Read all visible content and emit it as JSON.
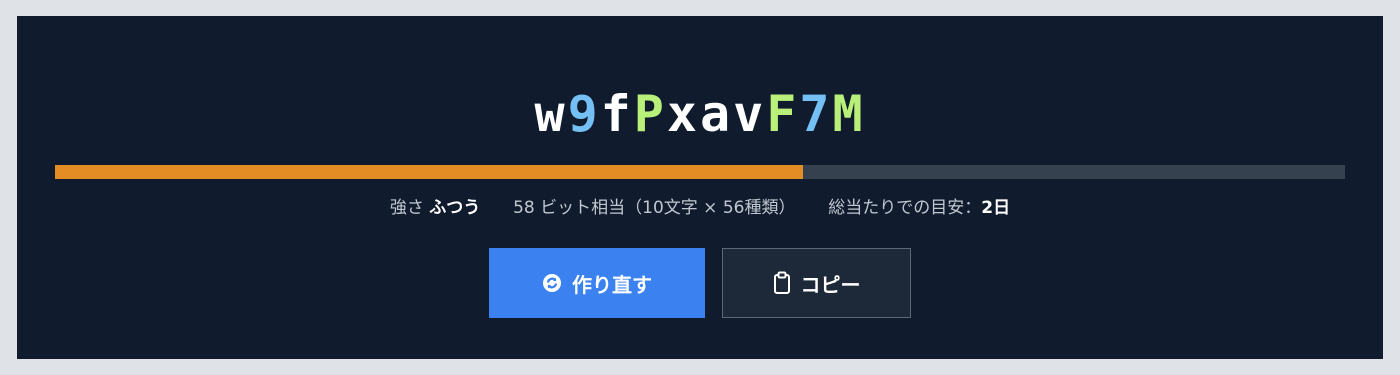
{
  "password": {
    "chars": [
      {
        "c": "w",
        "kind": "lower"
      },
      {
        "c": "9",
        "kind": "digit"
      },
      {
        "c": "f",
        "kind": "lower"
      },
      {
        "c": "P",
        "kind": "upper"
      },
      {
        "c": "x",
        "kind": "lower"
      },
      {
        "c": "a",
        "kind": "lower"
      },
      {
        "c": "v",
        "kind": "lower"
      },
      {
        "c": "F",
        "kind": "upper"
      },
      {
        "c": "7",
        "kind": "digit"
      },
      {
        "c": "M",
        "kind": "upper"
      }
    ]
  },
  "strength": {
    "label": "強さ",
    "value": "ふつう",
    "meter_fraction": 0.58,
    "bits_text": "58 ビット相当（10文字 × 56種類）",
    "estimate_label": "総当たりでの目安：",
    "estimate_value": "2日"
  },
  "buttons": {
    "regenerate_label": "作り直す",
    "copy_label": "コピー"
  },
  "icons": {
    "regenerate": "refresh-icon",
    "copy": "clipboard-icon"
  },
  "colors": {
    "background": "#101b2d",
    "digit": "#74bff4",
    "uppercase": "#b8f07a",
    "lowercase": "#ffffff",
    "meter_fill": "#e48d24",
    "meter_track": "#36414f",
    "primary_button": "#3b82f0"
  }
}
